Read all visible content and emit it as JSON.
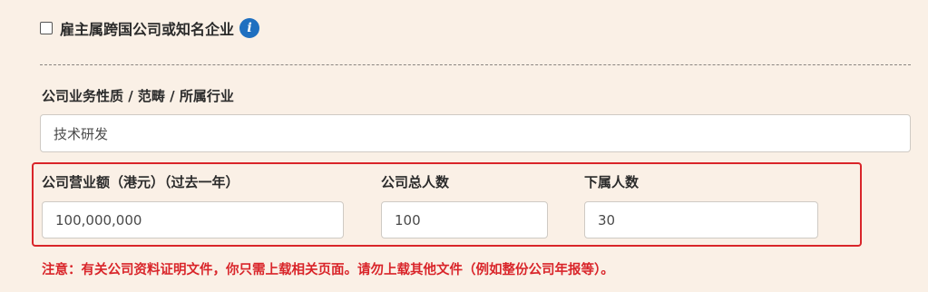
{
  "mnc_checkbox": {
    "label": "雇主属跨国公司或知名企业",
    "checked": false,
    "info_icon": "info-icon",
    "info_symbol": "i"
  },
  "business_nature": {
    "label": "公司业务性质 / 范畴 / 所属行业",
    "value": "技术研发"
  },
  "highlight": {
    "border_color": "#d9252a"
  },
  "turnover": {
    "label": "公司营业额（港元）（过去一年）",
    "value": "100,000,000"
  },
  "total_staff": {
    "label": "公司总人数",
    "value": "100"
  },
  "subordinates": {
    "label": "下属人数",
    "value": "30"
  },
  "note": "注意：有关公司资料证明文件，你只需上载相关页面。请勿上载其他文件（例如整份公司年报等）。",
  "colors": {
    "background": "#faf0e6",
    "accent_blue": "#1e6fc0",
    "warning_red": "#d9252a"
  }
}
